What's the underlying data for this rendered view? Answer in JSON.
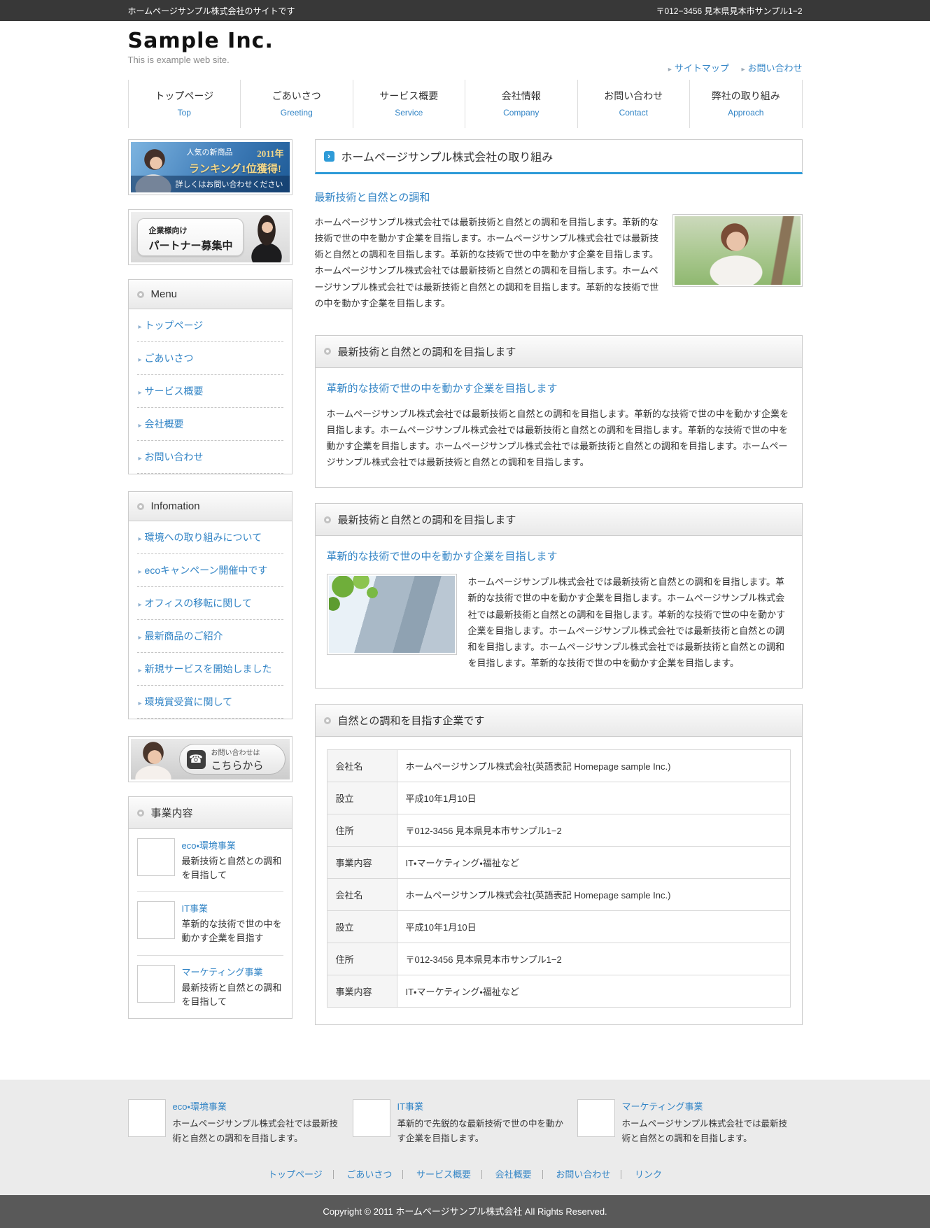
{
  "colors": {
    "accent_blue": "#3385c6",
    "title_underline_blue": "#2e9bd8",
    "topbar_bg": "#383838",
    "copyright_bg": "#595959",
    "footer_bg": "#ebebeb"
  },
  "icons": {
    "link_arrow": "▸",
    "title_chevron": "›",
    "phone": "☎"
  },
  "topbar": {
    "left": "ホームページサンプル株式会社のサイトです",
    "right": "〒012−3456 見本県見本市サンプル1−2"
  },
  "header": {
    "logo": "Sample Inc.",
    "tagline": "This is example web site.",
    "links": {
      "sitemap": "サイトマップ",
      "contact": "お問い合わせ"
    }
  },
  "nav": {
    "items": [
      {
        "jp": "トップページ",
        "en": "Top"
      },
      {
        "jp": "ごあいさつ",
        "en": "Greeting"
      },
      {
        "jp": "サービス概要",
        "en": "Service"
      },
      {
        "jp": "会社情報",
        "en": "Company"
      },
      {
        "jp": "お問い合わせ",
        "en": "Contact"
      },
      {
        "jp": "弊社の取り組み",
        "en": "Approach"
      }
    ]
  },
  "sidebar": {
    "banner_ranking": {
      "line1": "人気の新商品",
      "year": "2011年",
      "line2": "ランキング1位獲得!",
      "line3": "詳しくはお問い合わせください"
    },
    "banner_partner": {
      "line1": "企業様向け",
      "line2": "パートナー募集中"
    },
    "menu": {
      "title": "Menu",
      "items": [
        "トップページ",
        "ごあいさつ",
        "サービス概要",
        "会社概要",
        "お問い合わせ"
      ]
    },
    "information": {
      "title": "Infomation",
      "items": [
        "環境への取り組みについて",
        "ecoキャンペーン開催中です",
        "オフィスの移転に関して",
        "最新商品のご紹介",
        "新規サービスを開始しました",
        "環境賞受賞に関して"
      ]
    },
    "banner_contact": {
      "line1": "お問い合わせは",
      "line2": "こちらから"
    },
    "business": {
      "title": "事業内容",
      "items": [
        {
          "title": "eco・環境事業",
          "desc": "最新技術と自然との調和を目指して"
        },
        {
          "title": "IT事業",
          "desc": "革新的な技術で世の中を動かす企業を目指す"
        },
        {
          "title": "マーケティング事業",
          "desc": "最新技術と自然との調和を目指して"
        }
      ]
    }
  },
  "main": {
    "page_title": "ホームページサンプル株式会社の取り組み",
    "intro": {
      "heading": "最新技術と自然との調和",
      "text": "ホームページサンプル株式会社では最新技術と自然との調和を目指します。革新的な技術で世の中を動かす企業を目指します。ホームページサンプル株式会社では最新技術と自然との調和を目指します。革新的な技術で世の中を動かす企業を目指します。ホームページサンプル株式会社では最新技術と自然との調和を目指します。ホームページサンプル株式会社では最新技術と自然との調和を目指します。革新的な技術で世の中を動かす企業を目指します。"
    },
    "section1": {
      "title": "最新技術と自然との調和を目指します",
      "subheading": "革新的な技術で世の中を動かす企業を目指します",
      "text": "ホームページサンプル株式会社では最新技術と自然との調和を目指します。革新的な技術で世の中を動かす企業を目指します。ホームページサンプル株式会社では最新技術と自然との調和を目指します。革新的な技術で世の中を動かす企業を目指します。ホームページサンプル株式会社では最新技術と自然との調和を目指します。ホームページサンプル株式会社では最新技術と自然との調和を目指します。"
    },
    "section2": {
      "title": "最新技術と自然との調和を目指します",
      "subheading": "革新的な技術で世の中を動かす企業を目指します",
      "text": "ホームページサンプル株式会社では最新技術と自然との調和を目指します。革新的な技術で世の中を動かす企業を目指します。ホームページサンプル株式会社では最新技術と自然との調和を目指します。革新的な技術で世の中を動かす企業を目指します。ホームページサンプル株式会社では最新技術と自然との調和を目指します。ホームページサンプル株式会社では最新技術と自然との調和を目指します。革新的な技術で世の中を動かす企業を目指します。"
    },
    "section3": {
      "title": "自然との調和を目指す企業です",
      "rows": [
        {
          "label": "会社名",
          "value": "ホームページサンプル株式会社(英語表記 Homepage sample Inc.)"
        },
        {
          "label": "設立",
          "value": "平成10年1月10日"
        },
        {
          "label": "住所",
          "value": "〒012-3456 見本県見本市サンプル1−2"
        },
        {
          "label": "事業内容",
          "value": "IT・マーケティング・福祉など"
        },
        {
          "label": "会社名",
          "value": "ホームページサンプル株式会社(英語表記 Homepage sample Inc.)"
        },
        {
          "label": "設立",
          "value": "平成10年1月10日"
        },
        {
          "label": "住所",
          "value": "〒012-3456 見本県見本市サンプル1−2"
        },
        {
          "label": "事業内容",
          "value": "IT・マーケティング・福祉など"
        }
      ]
    }
  },
  "footer": {
    "columns": [
      {
        "title": "eco・環境事業",
        "text": "ホームページサンプル株式会社では最新技術と自然との調和を目指します。"
      },
      {
        "title": "IT事業",
        "text": "革新的で先鋭的な最新技術で世の中を動かす企業を目指します。"
      },
      {
        "title": "マーケティング事業",
        "text": "ホームページサンプル株式会社では最新技術と自然との調和を目指します。"
      }
    ],
    "links": [
      "トップページ",
      "ごあいさつ",
      "サービス概要",
      "会社概要",
      "お問い合わせ",
      "リンク"
    ],
    "copyright": "Copyright © 2011 ホームページサンプル株式会社 All Rights Reserved."
  }
}
